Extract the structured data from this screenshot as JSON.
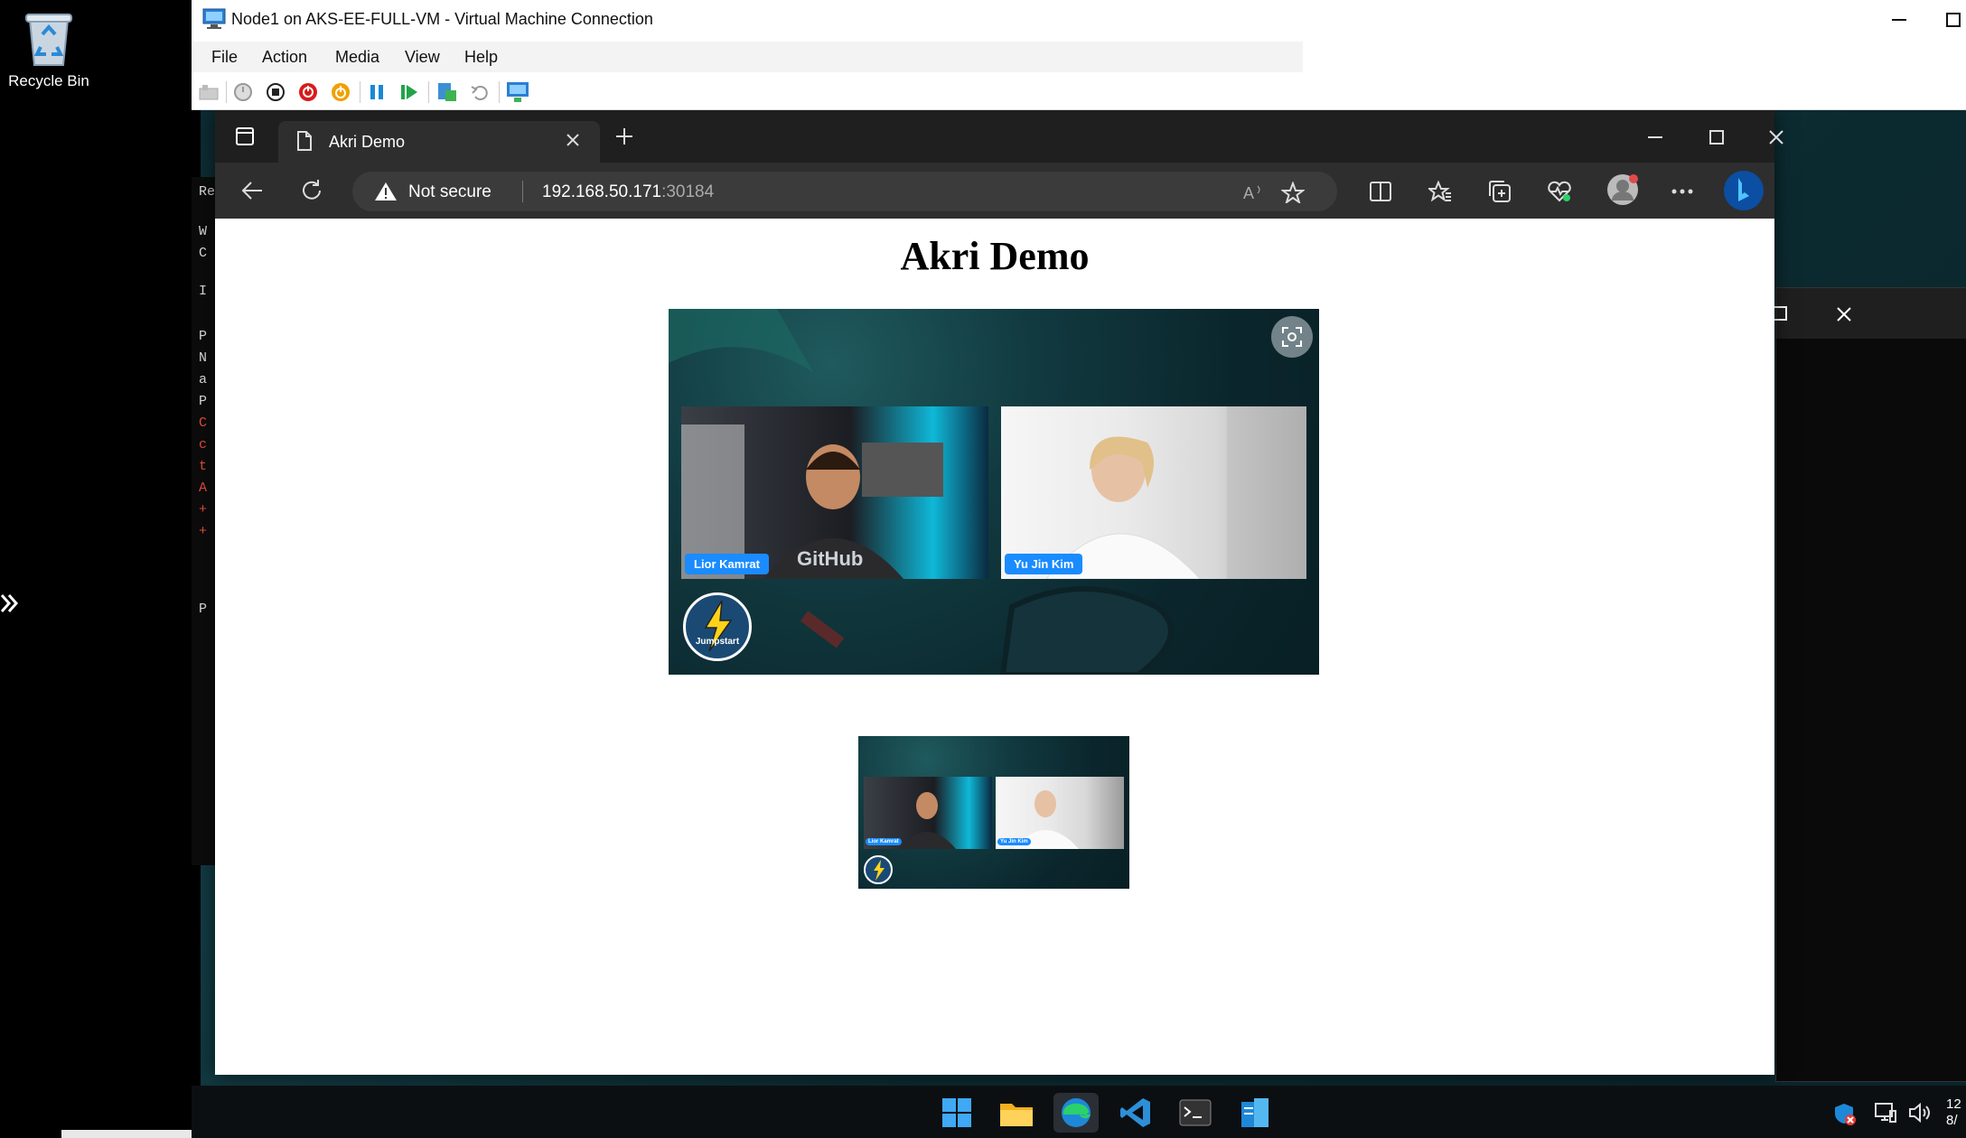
{
  "host": {
    "recycle_bin_label": "Recycle Bin"
  },
  "vm": {
    "title": "Node1 on AKS-EE-FULL-VM - Virtual Machine Connection",
    "menu": [
      "File",
      "Action",
      "Media",
      "View",
      "Help"
    ],
    "toolbar_icons": [
      "ctrl-alt-del-icon",
      "start-icon",
      "turn-off-icon",
      "shutdown-icon",
      "save-icon",
      "pause-icon",
      "resume-icon",
      "checkpoint-icon",
      "revert-icon",
      "enhanced-session-icon"
    ]
  },
  "guest": {
    "console_lines": [
      "Re",
      "W",
      "C",
      "I",
      "P",
      "N",
      "a",
      "P",
      "C",
      "c",
      "t",
      "A",
      "+",
      "+",
      "P"
    ],
    "taskbar_apps": [
      "start-icon",
      "file-explorer-icon",
      "edge-icon",
      "vscode-icon",
      "terminal-icon",
      "server-manager-icon"
    ],
    "clock": "12",
    "clock_sub": "8/"
  },
  "browser": {
    "tab_title": "Akri Demo",
    "security_label": "Not secure",
    "url_host": "192.168.50.171",
    "url_port": ":30184"
  },
  "page": {
    "heading": "Akri Demo",
    "participant_1": "Lior Kamrat",
    "participant_2": "Yu Jin Kim",
    "shirt_brand": "GitHub",
    "logo_text": "Jumpstart"
  },
  "colors": {
    "name_tag": "#1a8cff",
    "browser_chrome": "#2e2e2e",
    "guest_bg": "#123b44"
  }
}
